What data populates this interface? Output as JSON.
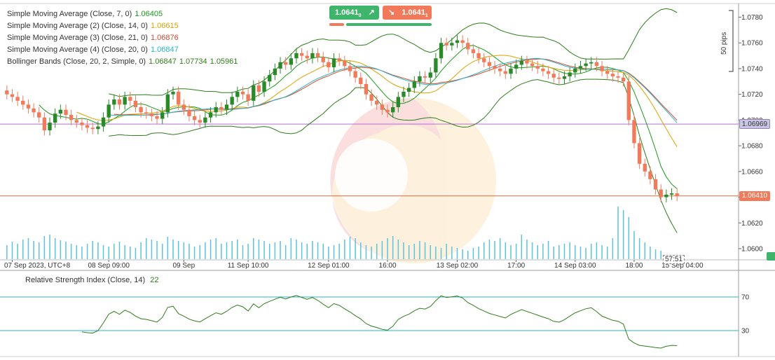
{
  "chart_data": {
    "type": "candlestick",
    "symbol_note": "",
    "price_axis": {
      "ticks": [
        "1.0780",
        "1.0760",
        "1.0740",
        "1.0720",
        "1.0700",
        "1.0680",
        "1.0660",
        "1.0640",
        "1.0620",
        "1.0600"
      ],
      "tick_values": [
        1.078,
        1.076,
        1.074,
        1.072,
        1.07,
        1.068,
        1.066,
        1.064,
        1.062,
        1.06
      ],
      "range": [
        1.0594,
        1.0789
      ],
      "scale_label": "50 pips",
      "horizontal_line": "1.06969",
      "current_price": "1.06410"
    },
    "time_axis": {
      "labels": [
        "07 Sep 2023, UTC+8",
        "08 Sep 09:00",
        "09 Sep",
        "11 Sep 10:00",
        "12 Sep 01:00",
        "16:00",
        "13 Sep 02:00",
        "17:00",
        "14 Sep 03:00",
        "18:00",
        "15 Sep 04:00"
      ],
      "label_bar_index": [
        1,
        19,
        33,
        45,
        60,
        71,
        84,
        95,
        106,
        117,
        126
      ]
    },
    "trade": {
      "buy_price": "1.0641",
      "buy_sup": "0",
      "sell_price": "1.0641",
      "sell_sup": "1"
    },
    "countdown": "57:51",
    "indicators": [
      {
        "label": "Simple Moving Average (Close, 7, 0)",
        "value": "1.06405",
        "color": "#1a9a1a",
        "period": 7
      },
      {
        "label": "Simple Moving Average (2) (Close, 14, 0)",
        "value": "1.06615",
        "color": "#e0a000",
        "period": 14
      },
      {
        "label": "Simple Moving Average (3) (Close, 21, 0)",
        "value": "1.06876",
        "color": "#d9472b",
        "period": 21
      },
      {
        "label": "Simple Moving Average (4) (Close, 20, 0)",
        "value": "1.06847",
        "color": "#26b5c8",
        "period": 20
      }
    ],
    "bollinger": {
      "label": "Bollinger Bands (Close, 20, 2, Simple, 0)",
      "values": [
        "1.06847",
        "1.07734",
        "1.05961"
      ],
      "color": "#2e7d1a"
    },
    "rsi": {
      "label": "Relative Strength Index (Close, 14)",
      "value": "22",
      "levels": [
        "70",
        "30"
      ],
      "level_values": [
        70,
        30
      ],
      "color": "#2e7d1a"
    },
    "closes": [
      1.072,
      1.0718,
      1.0715,
      1.0712,
      1.0709,
      1.0706,
      1.0702,
      1.0692,
      1.0698,
      1.0705,
      1.0708,
      1.0704,
      1.07,
      1.0698,
      1.0696,
      1.0694,
      1.0693,
      1.0695,
      1.0702,
      1.0712,
      1.0716,
      1.0712,
      1.0718,
      1.0715,
      1.071,
      1.0706,
      1.0705,
      1.0703,
      1.0701,
      1.0706,
      1.072,
      1.0722,
      1.0712,
      1.0708,
      1.0703,
      1.07,
      1.0698,
      1.0702,
      1.0706,
      1.071,
      1.0708,
      1.0712,
      1.0718,
      1.0722,
      1.072,
      1.0715,
      1.0727,
      1.0722,
      1.073,
      1.0735,
      1.074,
      1.0745,
      1.0743,
      1.0748,
      1.0752,
      1.075,
      1.0748,
      1.0752,
      1.0749,
      1.0745,
      1.0741,
      1.0748,
      1.0746,
      1.0742,
      1.0738,
      1.0733,
      1.0728,
      1.072,
      1.0715,
      1.0712,
      1.0708,
      1.0706,
      1.071,
      1.0718,
      1.0722,
      1.0725,
      1.073,
      1.0734,
      1.0733,
      1.0737,
      1.0748,
      1.076,
      1.0758,
      1.076,
      1.0762,
      1.076,
      1.0755,
      1.0752,
      1.0748,
      1.0745,
      1.0742,
      1.074,
      1.0738,
      1.0736,
      1.074,
      1.0743,
      1.0746,
      1.0744,
      1.0742,
      1.074,
      1.0738,
      1.0736,
      1.0733,
      1.0732,
      1.0734,
      1.0737,
      1.074,
      1.0742,
      1.0744,
      1.0745,
      1.0742,
      1.0738,
      1.0736,
      1.0734,
      1.0733,
      1.073,
      1.07,
      1.0682,
      1.0666,
      1.066,
      1.0654,
      1.0646,
      1.064,
      1.0642,
      1.0643,
      1.0641
    ],
    "volumes": [
      20,
      25,
      22,
      28,
      30,
      26,
      24,
      33,
      35,
      30,
      27,
      25,
      22,
      20,
      18,
      22,
      26,
      24,
      20,
      18,
      22,
      25,
      20,
      18,
      16,
      24,
      30,
      28,
      26,
      22,
      32,
      28,
      26,
      24,
      22,
      18,
      20,
      24,
      28,
      30,
      22,
      24,
      26,
      28,
      20,
      22,
      30,
      28,
      26,
      22,
      24,
      26,
      20,
      30,
      28,
      24,
      22,
      26,
      24,
      22,
      18,
      20,
      22,
      28,
      32,
      30,
      24,
      20,
      18,
      22,
      26,
      30,
      33,
      28,
      24,
      20,
      22,
      26,
      24,
      20,
      18,
      16,
      22,
      18,
      16,
      14,
      12,
      16,
      18,
      24,
      28,
      26,
      30,
      24,
      20,
      22,
      35,
      28,
      24,
      20,
      22,
      26,
      18,
      20,
      22,
      24,
      20,
      18,
      16,
      22,
      24,
      20,
      18,
      30,
      75,
      70,
      60,
      40,
      30,
      24,
      18,
      14,
      12
    ]
  }
}
